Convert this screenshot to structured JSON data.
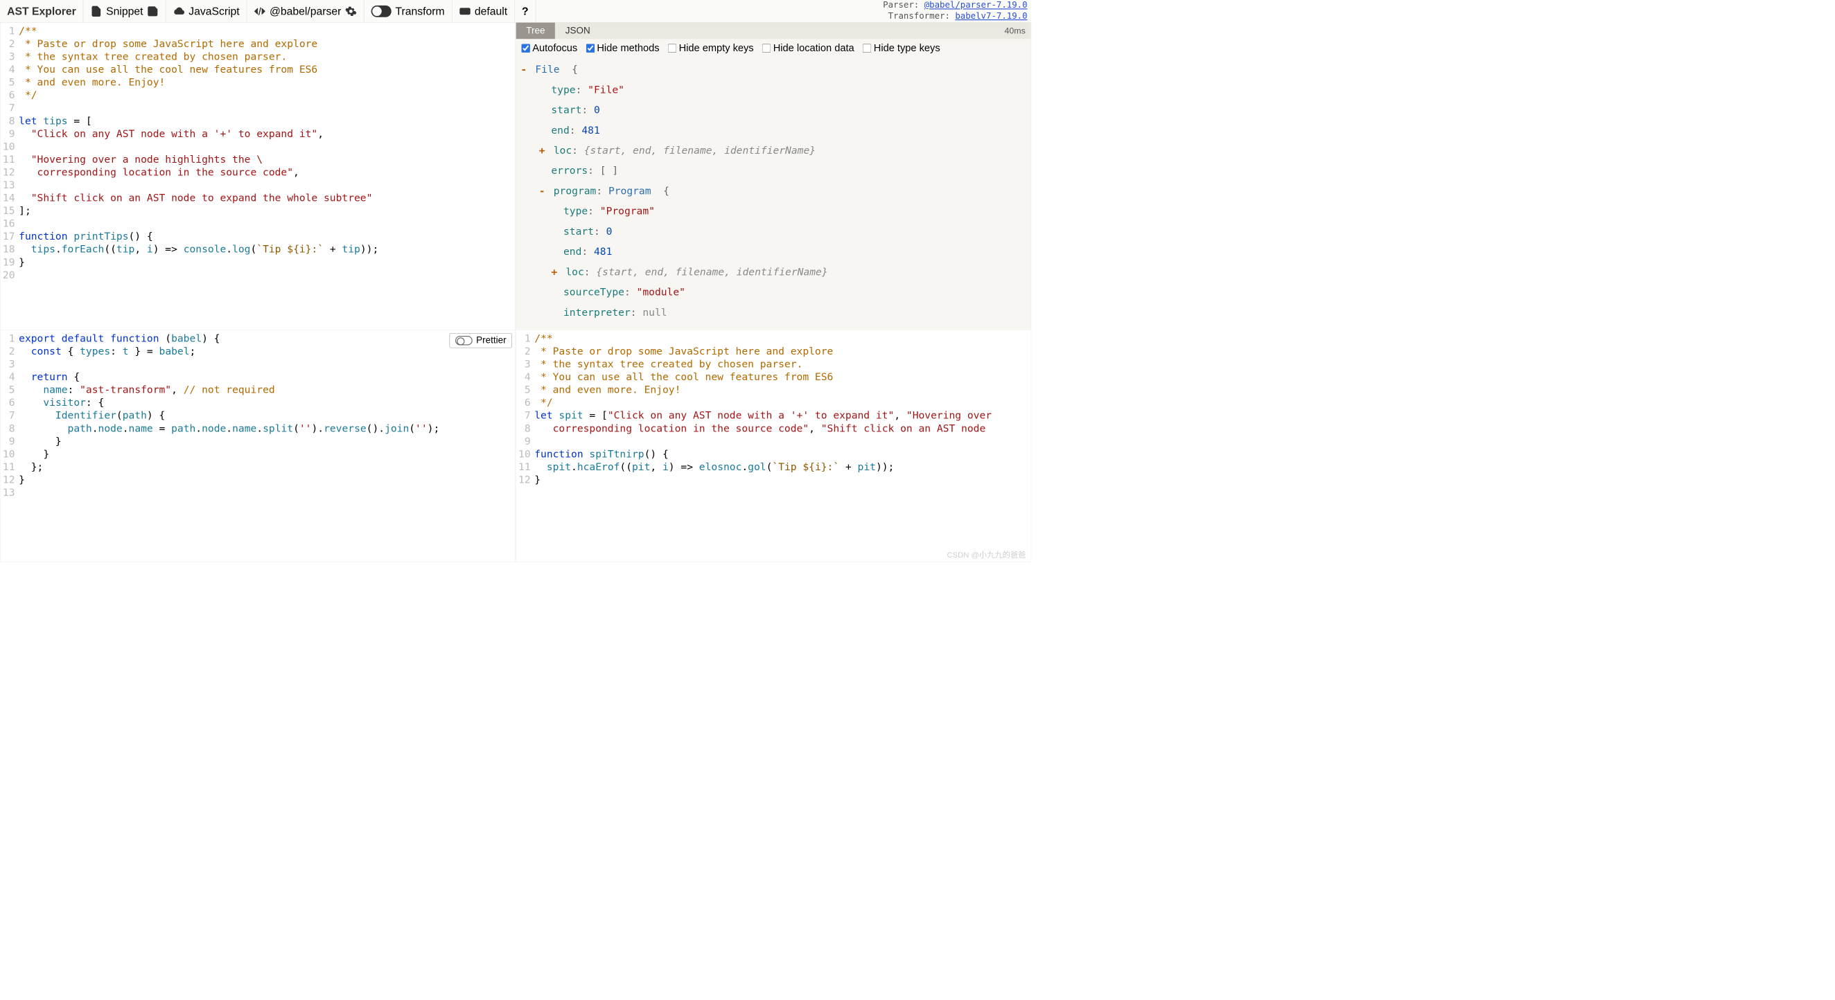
{
  "toolbar": {
    "logo": "AST Explorer",
    "snippet": "Snippet",
    "language": "JavaScript",
    "parser": "@babel/parser",
    "transform": "Transform",
    "preset": "default",
    "help": "?"
  },
  "meta": {
    "parser_label": "Parser: ",
    "parser_link": "@babel/parser-7.19.0",
    "transformer_label": "Transformer: ",
    "transformer_link": "babelv7-7.19.0"
  },
  "editor_top_left": {
    "lines": "1\n2\n3\n4\n5\n6\n7\n8\n9\n10\n11\n12\n13\n14\n15\n16\n17\n18\n19\n20",
    "code": "/**\n * Paste or drop some JavaScript here and explore\n * the syntax tree created by chosen parser.\n * You can use all the cool new features from ES6\n * and even more. Enjoy!\n */\n\nlet tips = [\n  \"Click on any AST node with a '+' to expand it\",\n\n  \"Hovering over a node highlights the \\\n   corresponding location in the source code\",\n\n  \"Shift click on an AST node to expand the whole subtree\"\n];\n\nfunction printTips() {\n  tips.forEach((tip, i) => console.log(`Tip ${i}:` + tip));\n}"
  },
  "editor_bottom_left": {
    "lines": "1\n2\n3\n4\n5\n6\n7\n8\n9\n10\n11\n12\n13",
    "code": "export default function (babel) {\n  const { types: t } = babel;\n\n  return {\n    name: \"ast-transform\", // not required\n    visitor: {\n      Identifier(path) {\n        path.node.name = path.node.name.split('').reverse().join('');\n      }\n    }\n  };\n}"
  },
  "editor_bottom_right": {
    "lines": "1\n2\n3\n4\n5\n6\n7\n8\n9\n10\n11\n12",
    "code": "/**\n * Paste or drop some JavaScript here and explore\n * the syntax tree created by chosen parser.\n * You can use all the cool new features from ES6\n * and even more. Enjoy!\n */\nlet spit = [\"Click on any AST node with a '+' to expand it\", \"Hovering over\n   corresponding location in the source code\", \"Shift click on an AST node\n\nfunction spiTtnirp() {\n  spit.hcaErof((pit, i) => elosnoc.gol(`Tip ${i}:` + pit));\n}"
  },
  "ast": {
    "tabs": {
      "tree": "Tree",
      "json": "JSON"
    },
    "timer": "40ms",
    "options": {
      "autofocus": "Autofocus",
      "hide_methods": "Hide methods",
      "hide_empty": "Hide empty keys",
      "hide_location": "Hide location data",
      "hide_type": "Hide type keys"
    },
    "checked": {
      "autofocus": true,
      "hide_methods": true,
      "hide_empty": false,
      "hide_location": false,
      "hide_type": false
    },
    "tree": {
      "file_label": "File",
      "type_file": "\"File\"",
      "start_0": "0",
      "end_481": "481",
      "loc_summary": "{start, end, filename, identifierName}",
      "errors_val": "[ ]",
      "program_label": "program",
      "program_type": "Program",
      "type_program": "\"Program\"",
      "start2": "0",
      "end2": "481",
      "sourceType": "\"module\"",
      "interpreter": "null"
    }
  },
  "prettier": "Prettier",
  "watermark": "CSDN @小九九的爸爸"
}
